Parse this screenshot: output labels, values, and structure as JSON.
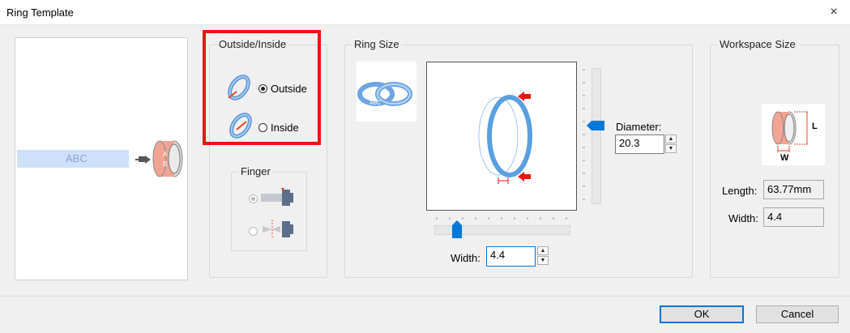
{
  "window": {
    "title": "Ring Template",
    "close_glyph": "×"
  },
  "preview": {
    "text": "ABC"
  },
  "outside_inside": {
    "label": "Outside/Inside",
    "options": [
      {
        "label": "Outside",
        "checked": true
      },
      {
        "label": "Inside",
        "checked": false
      }
    ]
  },
  "finger": {
    "label": "Finger"
  },
  "ring_size": {
    "label": "Ring Size",
    "diameter_label": "Diameter:",
    "diameter_value": "20.3",
    "width_label": "Width:",
    "width_value": "4.4",
    "icon_text": "ABC"
  },
  "workspace_size": {
    "label": "Workspace Size",
    "diagram_labels": {
      "l": "L",
      "w": "W"
    },
    "length_label": "Length:",
    "length_value": "63.77mm",
    "width_label": "Width:",
    "width_value": "4.4"
  },
  "buttons": {
    "ok": "OK",
    "cancel": "Cancel"
  },
  "colors": {
    "accent": "#0078d7",
    "highlight": "#ee1111",
    "ring_blue": "#5aa0e0"
  }
}
